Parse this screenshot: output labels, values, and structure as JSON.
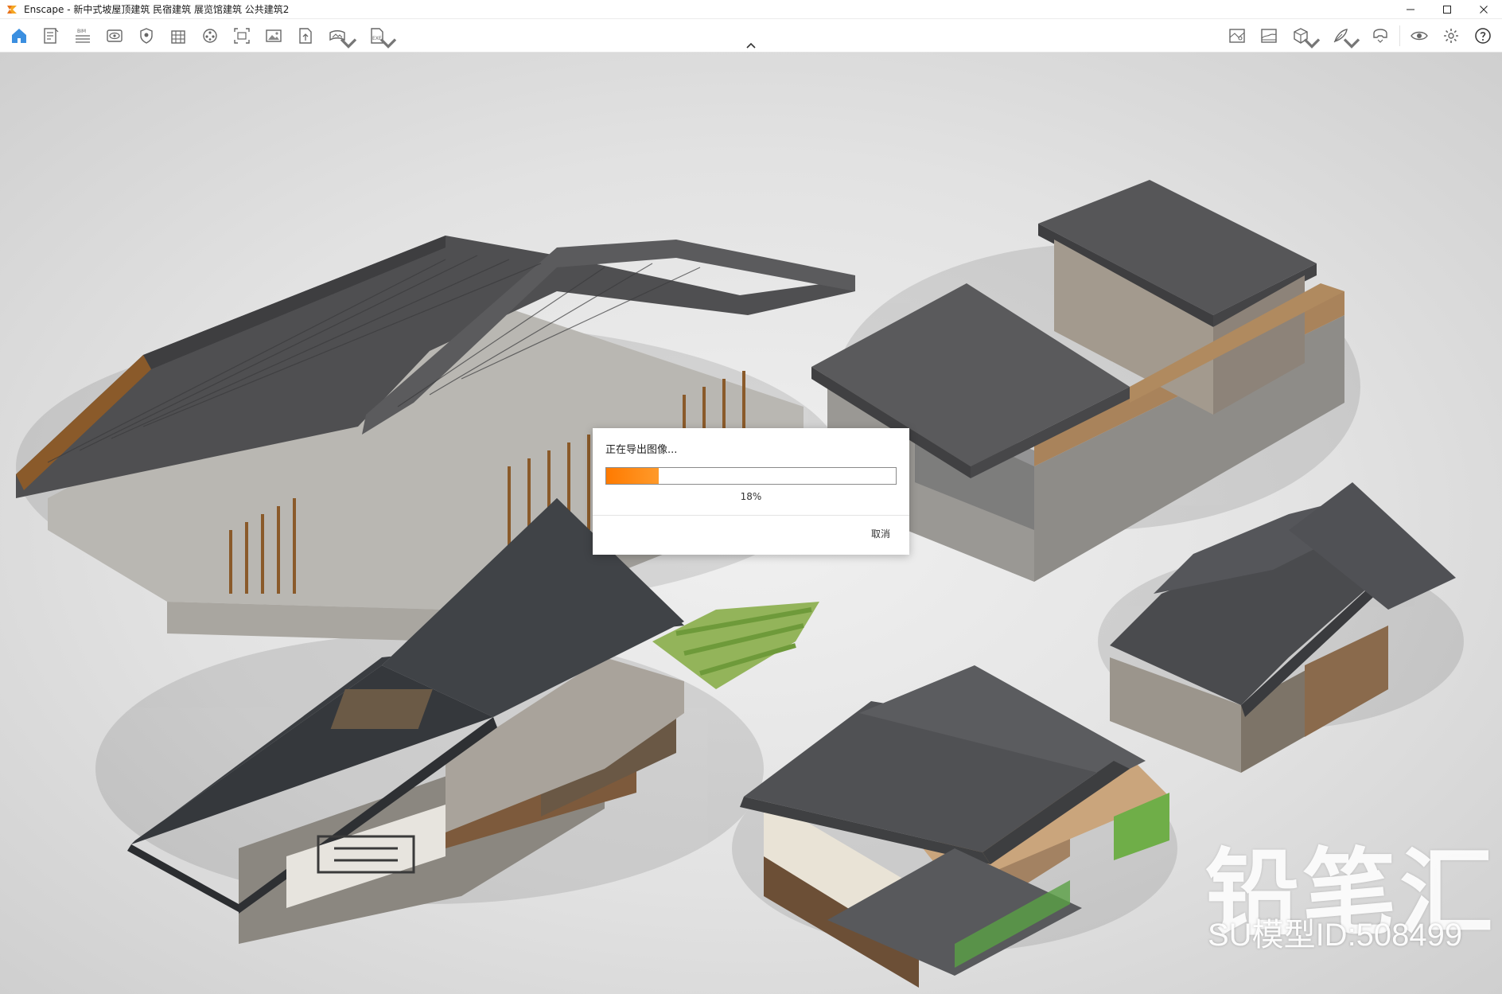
{
  "window": {
    "app_name": "Enscape",
    "title": "Enscape - 新中式坡屋顶建筑 民宿建筑 展览馆建筑 公共建筑2",
    "controls": [
      "minimize-icon",
      "maximize-icon",
      "close-icon"
    ]
  },
  "toolbar": {
    "left": [
      {
        "name": "home",
        "icon": "home-icon",
        "accent": "#3b8fe0",
        "caret": false
      },
      {
        "name": "export-doc",
        "icon": "document-icon",
        "caret": false
      },
      {
        "name": "bim",
        "icon": "bim-icon",
        "label": "BIM",
        "caret": false
      },
      {
        "name": "view",
        "icon": "eye-icon",
        "caret": false
      },
      {
        "name": "shield",
        "icon": "shield-icon",
        "caret": false
      },
      {
        "name": "building",
        "icon": "building-icon",
        "caret": false
      },
      {
        "name": "video",
        "icon": "video-reel-icon",
        "caret": false
      },
      {
        "name": "frame",
        "icon": "frame-capture-icon",
        "caret": false
      },
      {
        "name": "image",
        "icon": "image-icon",
        "caret": false
      },
      {
        "name": "export-file",
        "icon": "file-export-icon",
        "caret": false
      },
      {
        "name": "panorama",
        "icon": "panorama-icon",
        "caret": true
      },
      {
        "name": "exe",
        "icon": "exe-export-icon",
        "label": "EXE",
        "caret": true
      }
    ],
    "right": [
      {
        "name": "map",
        "icon": "site-map-icon",
        "caret": false
      },
      {
        "name": "landscape",
        "icon": "landscape-icon",
        "caret": false
      },
      {
        "name": "cube",
        "icon": "cube-icon",
        "caret": true
      },
      {
        "name": "feather",
        "icon": "feather-icon",
        "caret": true
      },
      {
        "name": "headset",
        "icon": "vr-headset-icon",
        "caret": false
      },
      {
        "name": "visual-settings",
        "icon": "eye-settings-icon",
        "caret": false
      },
      {
        "name": "settings",
        "icon": "gear-icon",
        "caret": false
      },
      {
        "name": "help",
        "icon": "help-icon",
        "caret": false
      }
    ],
    "collapse_icon": "chevron-up-icon"
  },
  "dialog": {
    "title": "正在导出图像...",
    "progress": 0.18,
    "progress_text": "18%",
    "cancel_label": "取消",
    "bar_color": "#ff7a00"
  },
  "watermark": {
    "brand": "铅笔汇",
    "model_id": "SU模型ID:508499"
  }
}
